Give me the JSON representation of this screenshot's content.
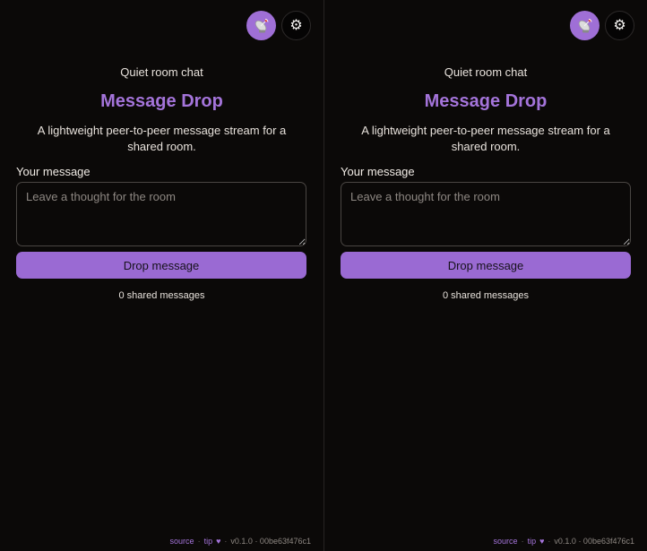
{
  "panes": [
    {
      "kicker": "Quiet room chat",
      "title": "Message Drop",
      "subtitle": "A lightweight peer-to-peer message stream for a shared room.",
      "field_label": "Your message",
      "input_placeholder": "Leave a thought for the room",
      "input_value": "",
      "button_label": "Drop message",
      "count_text": "0 shared messages",
      "peer_icon": "satellite-dish-icon",
      "settings_icon": "gear-icon",
      "settings_glyph": "⚙",
      "footer": {
        "source": "source",
        "sep": "·",
        "tip": "tip",
        "heart": "♥",
        "version": "v0.1.0 · 00be63f476c1"
      }
    },
    {
      "kicker": "Quiet room chat",
      "title": "Message Drop",
      "subtitle": "A lightweight peer-to-peer message stream for a shared room.",
      "field_label": "Your message",
      "input_placeholder": "Leave a thought for the room",
      "input_value": "",
      "button_label": "Drop message",
      "count_text": "0 shared messages",
      "peer_icon": "satellite-dish-icon",
      "settings_icon": "gear-icon",
      "settings_glyph": "⚙",
      "footer": {
        "source": "source",
        "sep": "·",
        "tip": "tip",
        "heart": "♥",
        "version": "v0.1.0 · 00be63f476c1"
      }
    }
  ],
  "colors": {
    "background": "#0b0908",
    "accent": "#a474da",
    "button": "#9a6ad3",
    "text": "#e8e2dc"
  }
}
